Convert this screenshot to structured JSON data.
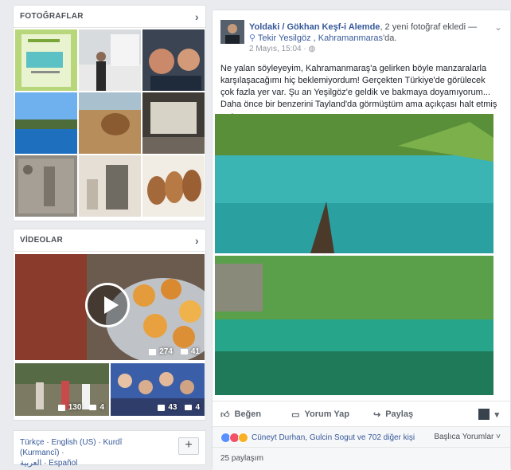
{
  "photos_card": {
    "title": "FOTOĞRAFLAR",
    "chevron": "chevron-right-icon"
  },
  "videos_card": {
    "title": "VİDEOLAR",
    "chevron": "chevron-right-icon",
    "main_video": {
      "likes": "274",
      "comments": "41"
    },
    "small_videos": [
      {
        "likes": "130",
        "comments": "4"
      },
      {
        "likes": "43",
        "comments": "4"
      }
    ]
  },
  "languages": {
    "items": [
      "Türkçe",
      "English (US)",
      "Kurdî (Kurmancî)",
      "العربية",
      "Español"
    ],
    "separator": " · ",
    "add_button": "+"
  },
  "post": {
    "author": "Yoldaki / Gökhan Keşf-i Alemde",
    "action": ", 2 yeni fotoğraf ekledi —",
    "location_prefix": "Tekir Yesilgöz , Kahramanmaras",
    "location_suffix": "'da.",
    "timestamp": "2 Mayıs, 15:04 · ",
    "text": "Ne yalan söyleyeyim, Kahramanmaraş'a gelirken böyle manzaralarla karşılaşacağımı hiç beklemiyordum! Gerçekten Türkiye'de görülecek çok fazla yer var. Şu an Yeşilgöz'e geldik ve bakmaya doyamıyorum... Daha önce bir benzerini Tayland'da görmüştüm ama açıkçası halt etmiş o ",
    "actions": {
      "like": "Beğen",
      "comment": "Yorum Yap",
      "share": "Paylaş"
    },
    "reactions_text": "Cüneyt Durhan, Gulcin Sogut ve 702 diğer kişi",
    "sort_label": "Başlıca Yorumlar",
    "shares": "25 paylaşım"
  },
  "colors": {
    "link": "#365899",
    "background": "#e9ebee",
    "like_blue": "#5890ff",
    "love_red": "#f25268",
    "wow_yellow": "#f7b125"
  }
}
